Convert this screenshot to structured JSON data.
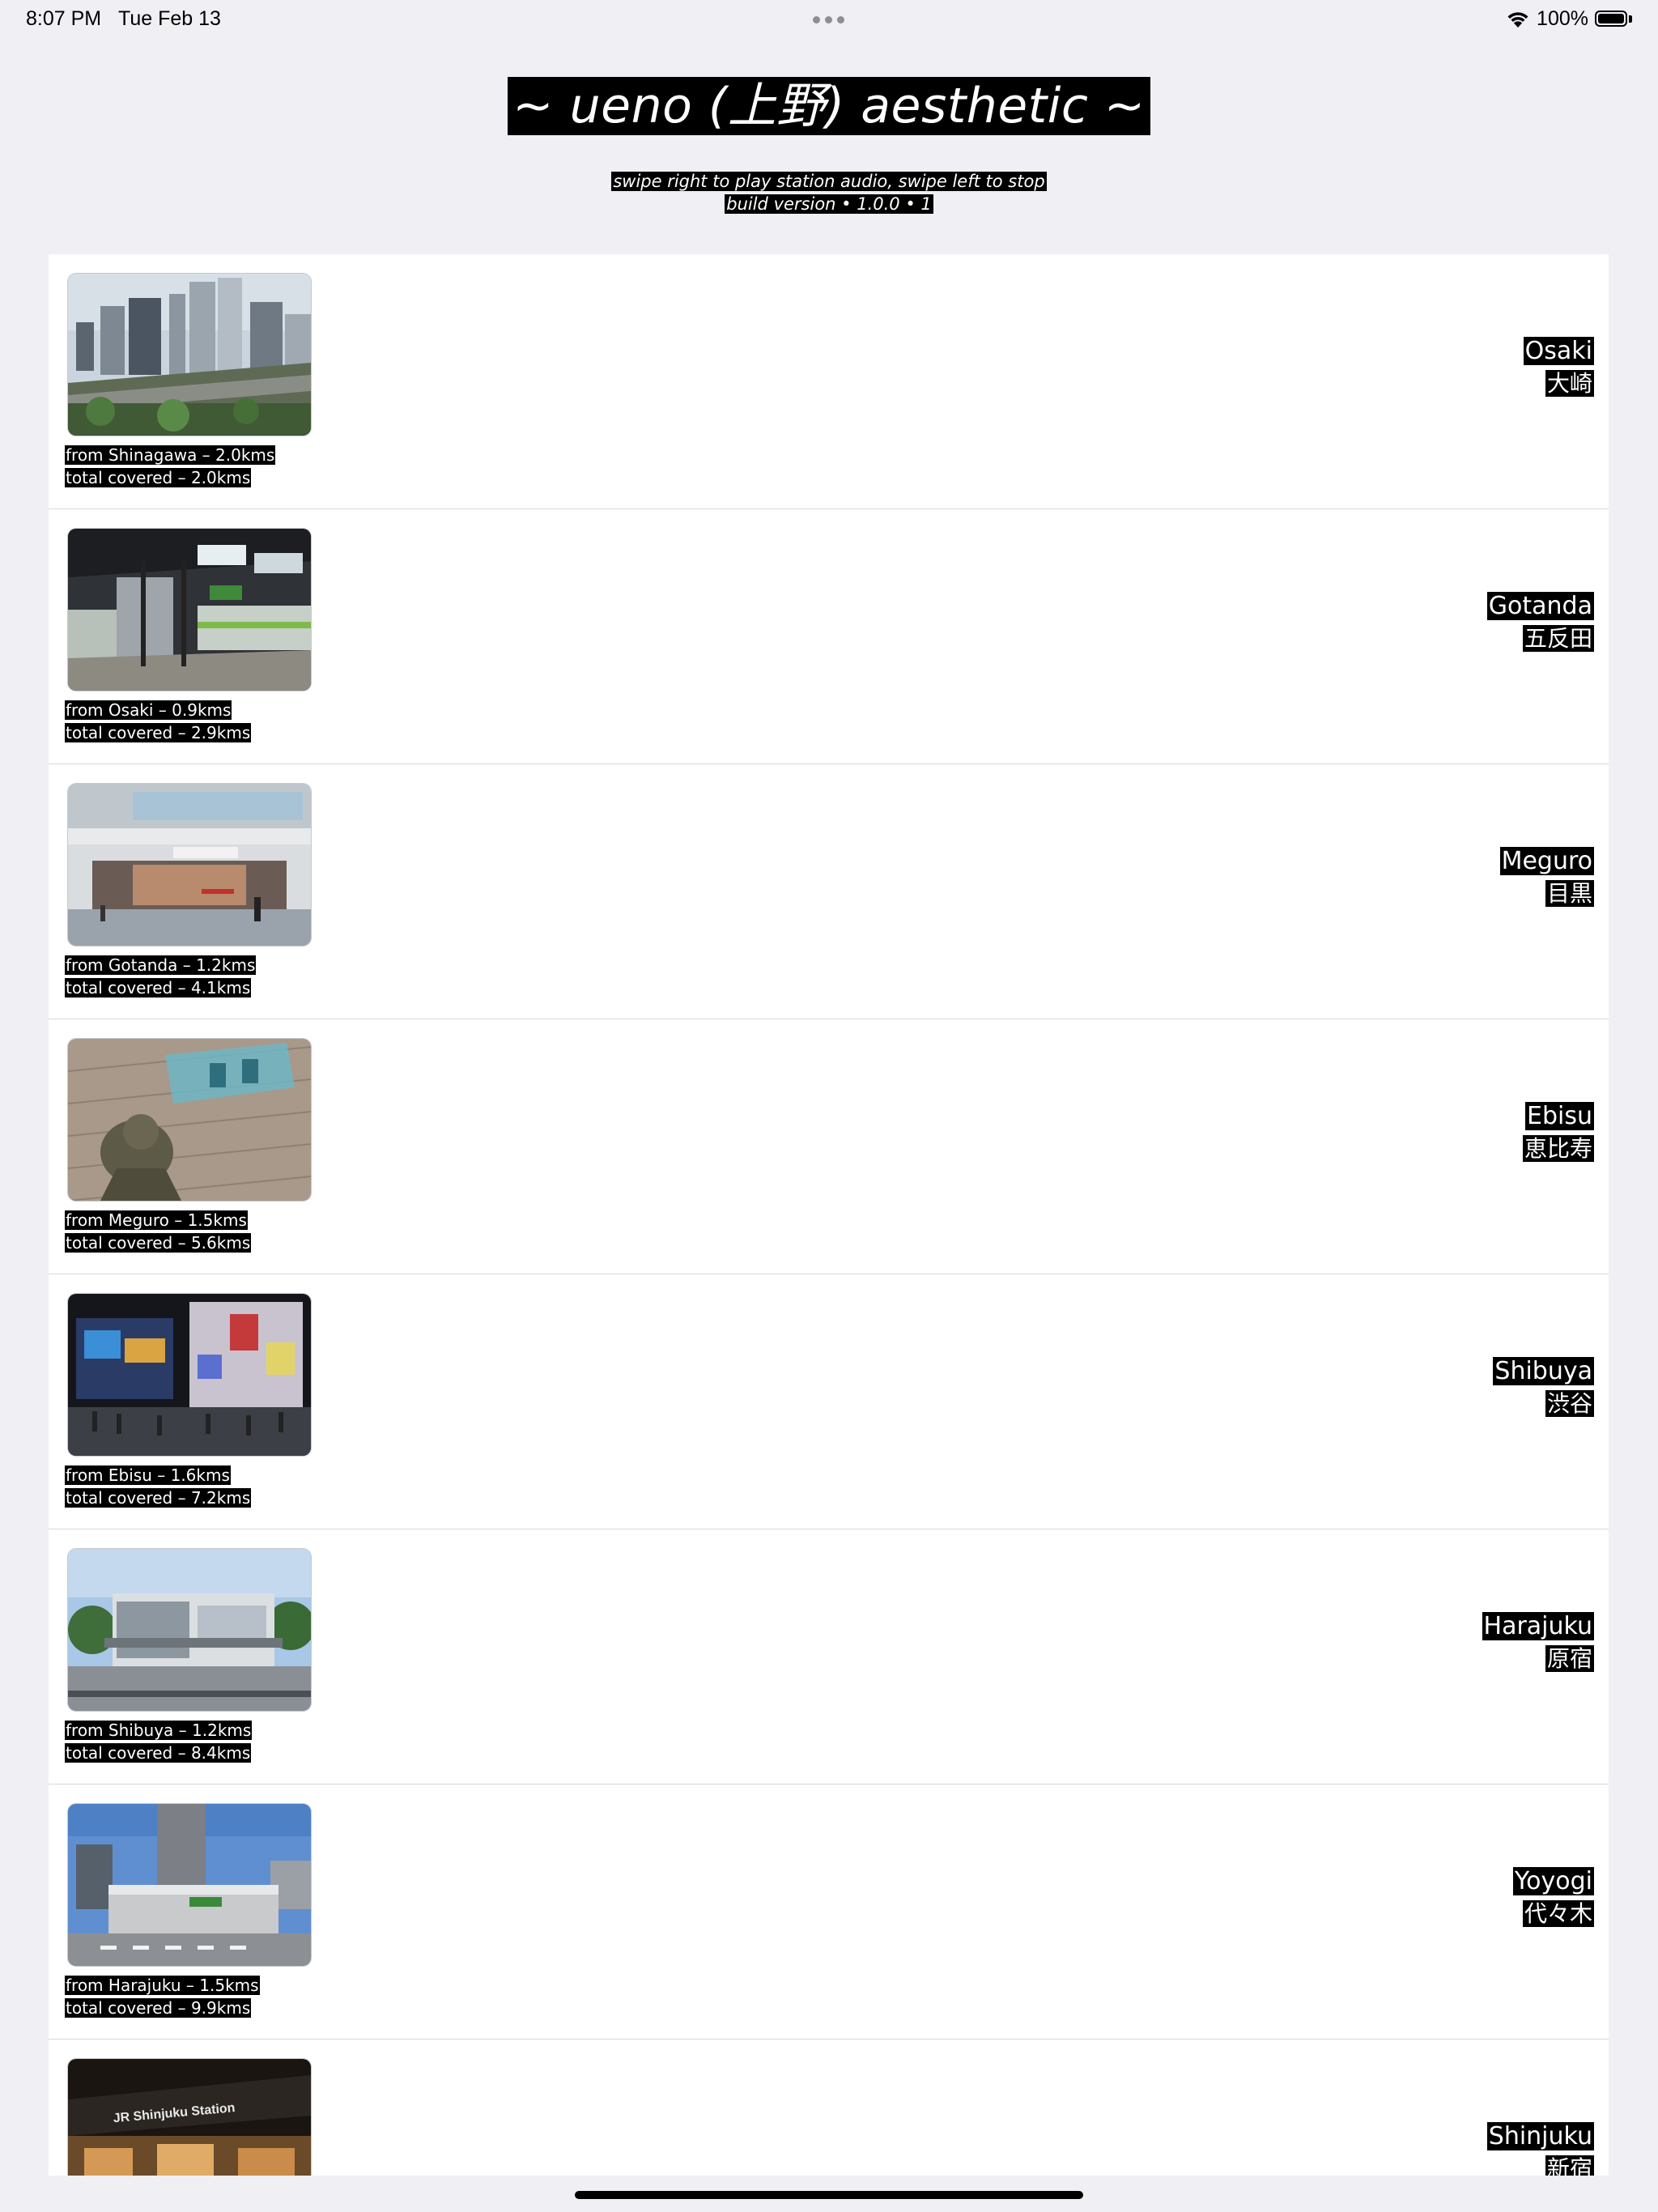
{
  "status_bar": {
    "time": "8:07 PM",
    "date": "Tue Feb 13",
    "battery": "100%",
    "icons": [
      "more-dots-icon",
      "wifi-icon",
      "battery-icon"
    ]
  },
  "header": {
    "title": "~ ueno (上野) aesthetic ~",
    "instructions": "swipe right to play station audio, swipe left to stop",
    "build": "build version • 1.0.0 • 1"
  },
  "stations": [
    {
      "en": "Osaki",
      "jp": "大崎",
      "from": "from Shinagawa – 2.0kms",
      "total": "total covered – 2.0kms",
      "photo": "osaki-skyline-photo"
    },
    {
      "en": "Gotanda",
      "jp": "五反田",
      "from": "from Osaki – 0.9kms",
      "total": "total covered – 2.9kms",
      "photo": "gotanda-platform-photo"
    },
    {
      "en": "Meguro",
      "jp": "目黒",
      "from": "from Gotanda – 1.2kms",
      "total": "total covered – 4.1kms",
      "photo": "meguro-entrance-photo"
    },
    {
      "en": "Ebisu",
      "jp": "恵比寿",
      "from": "from Meguro – 1.5kms",
      "total": "total covered – 5.6kms",
      "photo": "ebisu-statue-photo"
    },
    {
      "en": "Shibuya",
      "jp": "渋谷",
      "from": "from Ebisu – 1.6kms",
      "total": "total covered – 7.2kms",
      "photo": "shibuya-night-photo"
    },
    {
      "en": "Harajuku",
      "jp": "原宿",
      "from": "from Shibuya – 1.2kms",
      "total": "total covered – 8.4kms",
      "photo": "harajuku-station-photo"
    },
    {
      "en": "Yoyogi",
      "jp": "代々木",
      "from": "from Harajuku – 1.5kms",
      "total": "total covered – 9.9kms",
      "photo": "yoyogi-station-photo"
    },
    {
      "en": "Shinjuku",
      "jp": "新宿",
      "from": "",
      "total": "",
      "photo": "shinjuku-station-photo"
    }
  ]
}
